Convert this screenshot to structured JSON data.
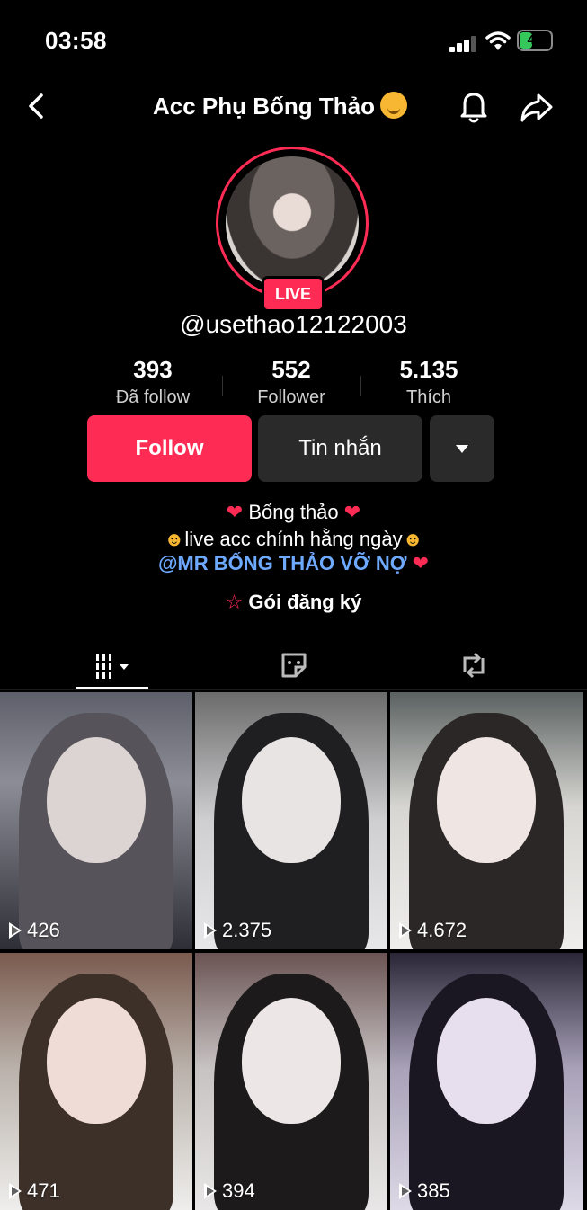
{
  "status_bar": {
    "time": "03:58",
    "battery": "40"
  },
  "header": {
    "title": "Acc Phụ Bống Thảo"
  },
  "profile": {
    "live_label": "LIVE",
    "username": "@usethao12122003",
    "stats": [
      {
        "value": "393",
        "label": "Đã follow"
      },
      {
        "value": "552",
        "label": "Follower"
      },
      {
        "value": "5.135",
        "label": "Thích"
      }
    ],
    "buttons": {
      "follow": "Follow",
      "message": "Tin nhắn"
    },
    "bio": {
      "line1": "Bống thảo",
      "line2": "live acc chính hằng ngày",
      "line3": "@MR BỐNG THẢO VỠ NỢ"
    },
    "subscription": "Gói đăng ký"
  },
  "tabs": [
    "videos-tab",
    "favorites-tab",
    "reposts-tab"
  ],
  "videos": [
    {
      "views": "426"
    },
    {
      "views": "2.375"
    },
    {
      "views": "4.672"
    },
    {
      "views": "471"
    },
    {
      "views": "394"
    },
    {
      "views": "385"
    }
  ],
  "colors": {
    "accent": "#fe2c55",
    "link": "#6da9ff",
    "button_dark": "#2a2a2a"
  }
}
